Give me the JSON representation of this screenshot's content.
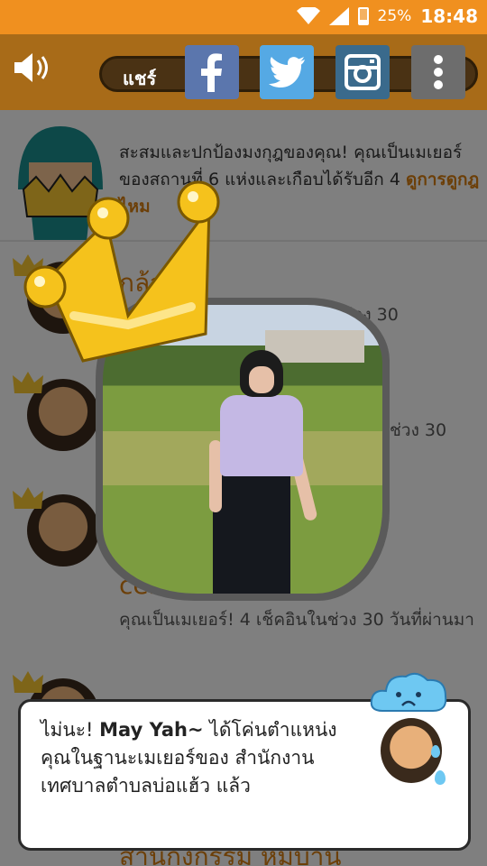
{
  "status_bar": {
    "battery": "25%",
    "time": "18:48"
  },
  "toolbar": {
    "share_label": "แชร์",
    "buttons": [
      {
        "name": "facebook",
        "color": "#5b76ad",
        "icon": "facebook-icon"
      },
      {
        "name": "twitter",
        "color": "#55a9e4",
        "icon": "twitter-icon"
      },
      {
        "name": "instagram",
        "color": "#3a6a8c",
        "icon": "instagram-icon"
      },
      {
        "name": "more",
        "color": "#6d6d6d",
        "icon": "more-vertical-icon"
      }
    ]
  },
  "intro": {
    "text": "สะสมและปกป้องมงกุฎของคุณ! คุณเป็นเมเยอร์ของสถานที่ 6 แห่งและเกือบได้รับอีก 4",
    "link": "ดูการดูกฎไหม"
  },
  "rows": [
    {
      "title": "กล้วยไม้",
      "subtitle": "เช็คอินในช่วง 30"
    },
    {
      "title": "",
      "subtitle": "ช่วง 30"
    },
    {
      "title": "cen...ampang",
      "subtitle": "คุณเป็นเมเยอร์! 4 เช็คอินในช่วง 30 วันที่ผ่านมา"
    },
    {
      "title": "",
      "subtitle": ""
    },
    {
      "title": "สำนักงกรรม หมู่บ้าน",
      "subtitle": ""
    }
  ],
  "notice": {
    "prefix": "ไม่นะ!",
    "user": "May Yah~",
    "message": "ได้โค่นตำแหน่งคุณในฐานะเมเยอร์ของ สำนักงานเทศบาลตำบลบ่อแฮ้ว แล้ว"
  },
  "colors": {
    "status_bar": "#f0901f",
    "toolbar": "#a86b18",
    "accent": "#d07a10"
  }
}
